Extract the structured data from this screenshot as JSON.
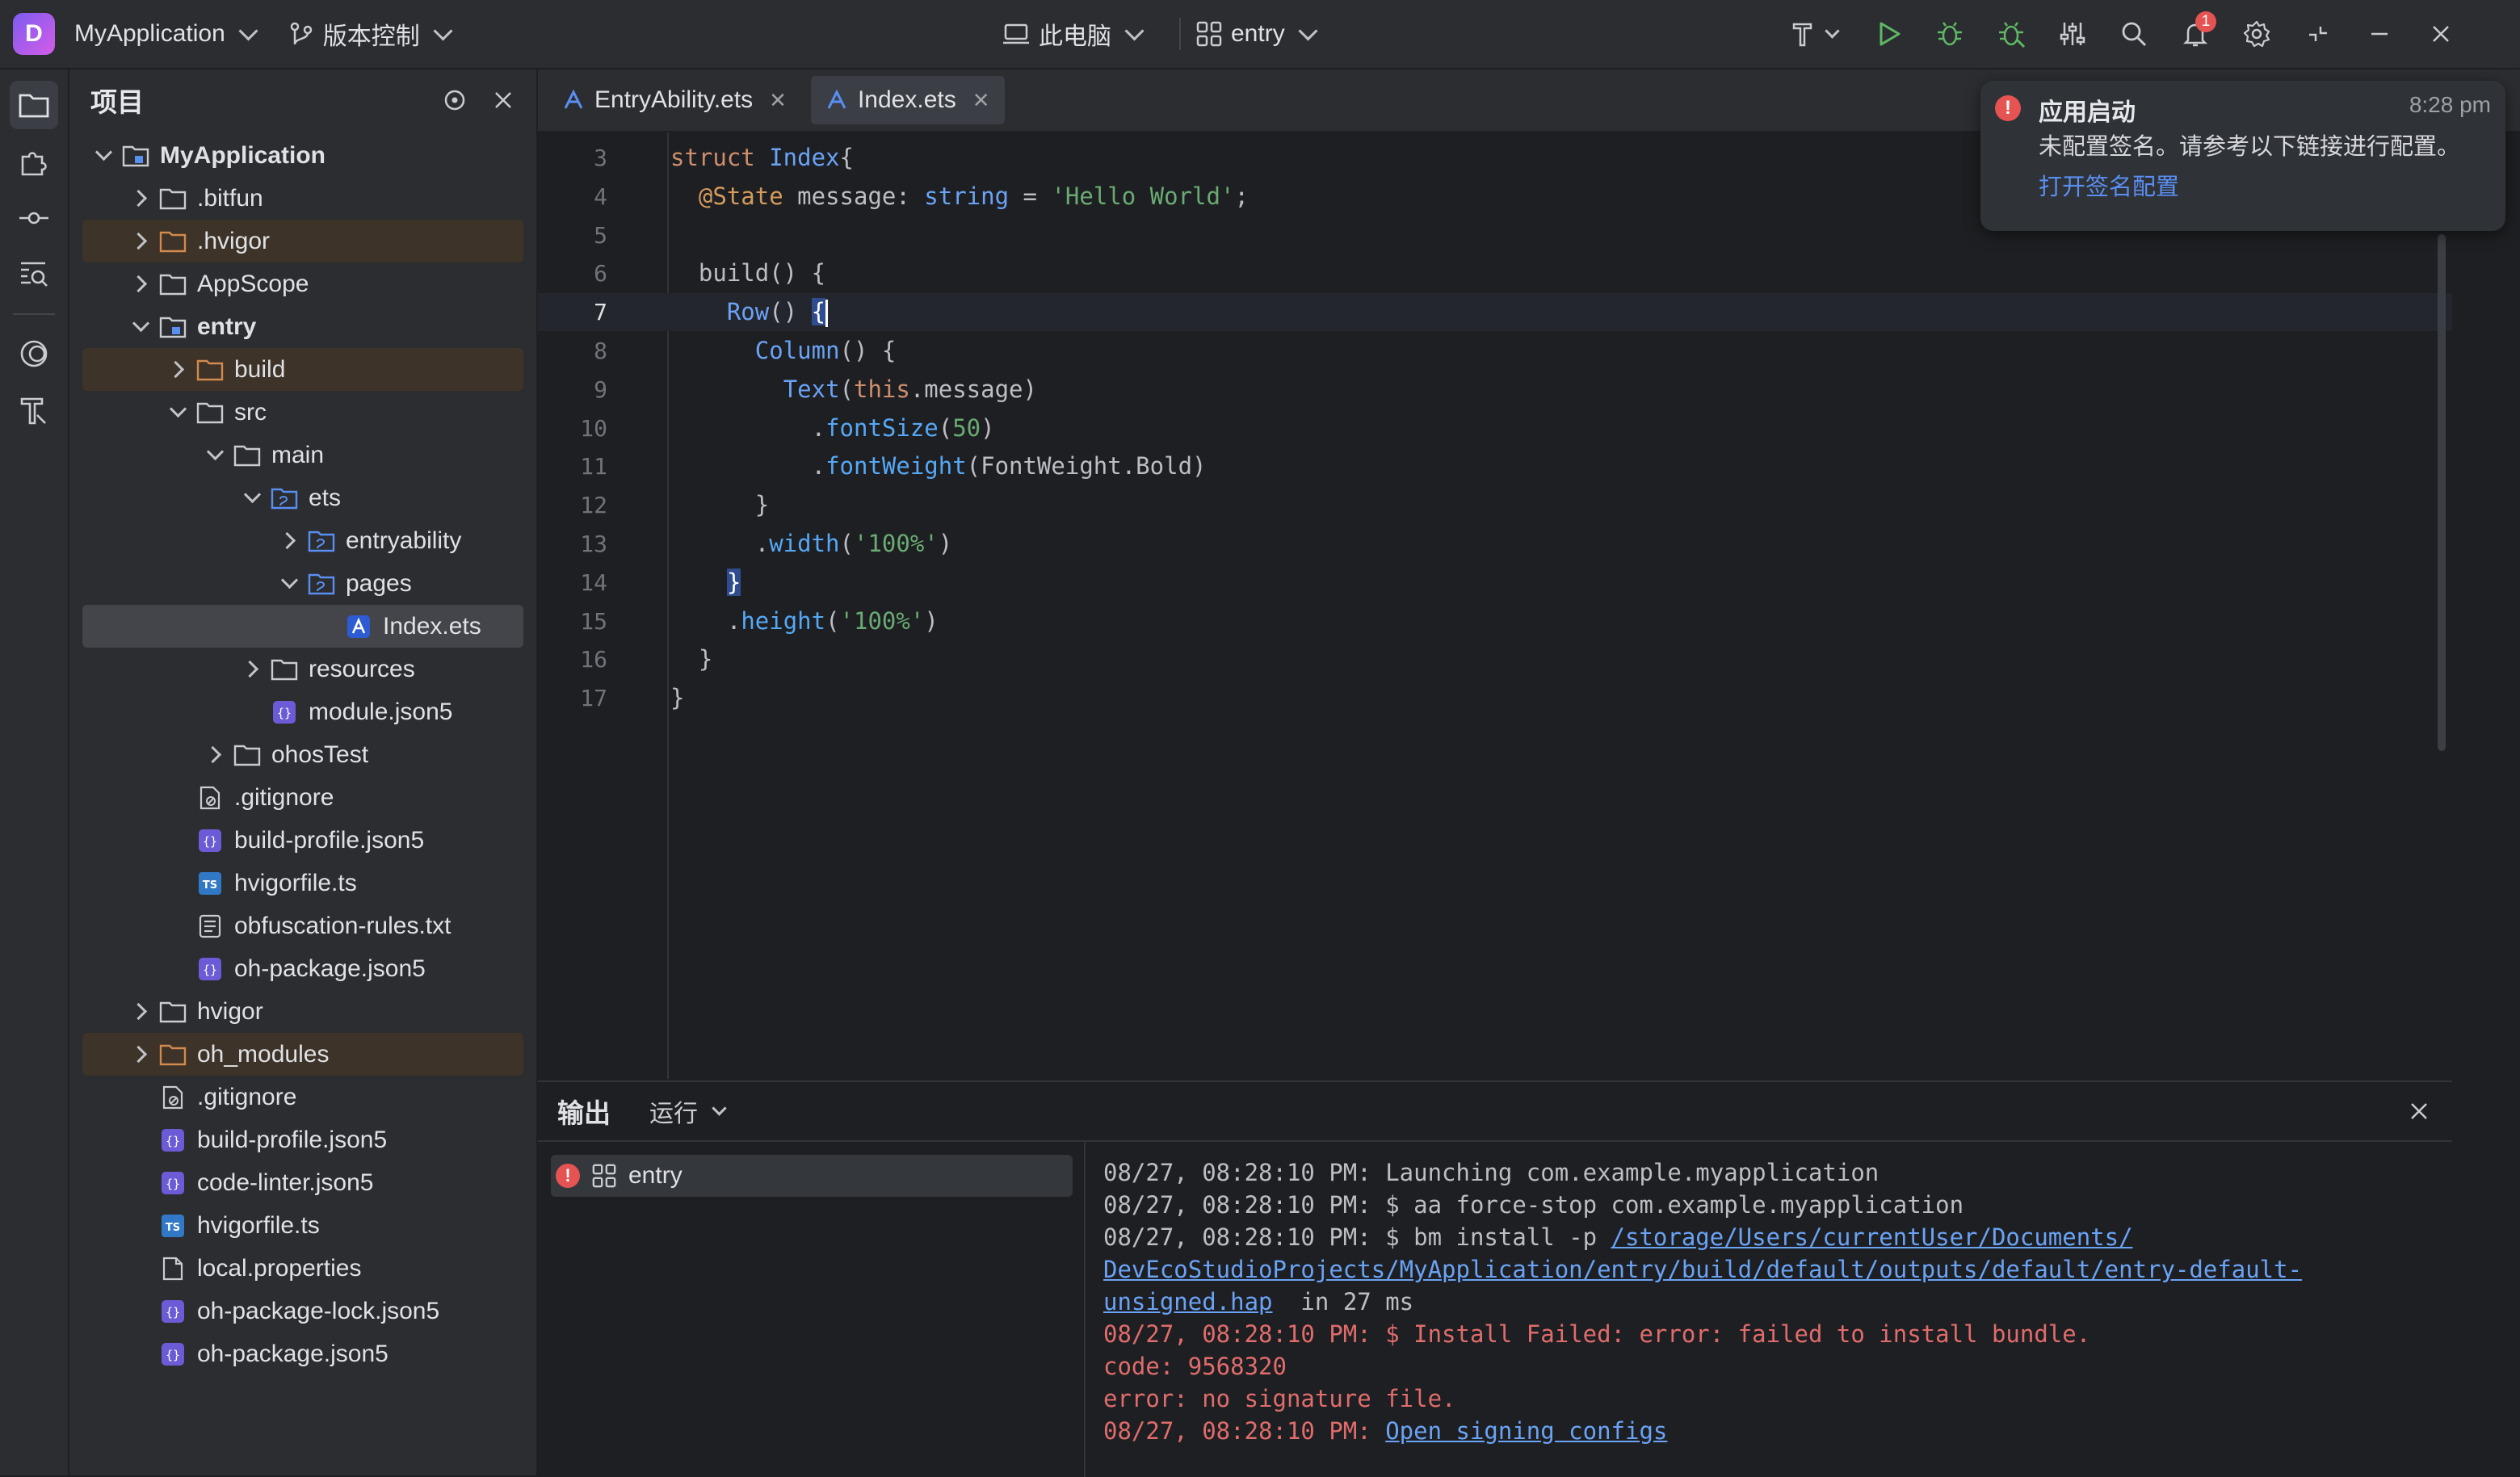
{
  "titlebar": {
    "project_name": "MyApplication",
    "vcs_label": "版本控制",
    "device_label": "此电脑",
    "module_label": "entry",
    "notification_count": "1"
  },
  "project_panel": {
    "title": "项目",
    "tree": [
      {
        "label": "MyApplication",
        "depth": 0,
        "expand": "open",
        "icon": "module-folder-icon",
        "bold": true
      },
      {
        "label": ".bitfun",
        "depth": 1,
        "expand": "closed",
        "icon": "folder-icon"
      },
      {
        "label": ".hvigor",
        "depth": 1,
        "expand": "closed",
        "icon": "excluded-folder-icon",
        "state": "excluded"
      },
      {
        "label": "AppScope",
        "depth": 1,
        "expand": "closed",
        "icon": "folder-icon"
      },
      {
        "label": "entry",
        "depth": 1,
        "expand": "open",
        "icon": "module-folder-icon",
        "bold": true
      },
      {
        "label": "build",
        "depth": 2,
        "expand": "closed",
        "icon": "excluded-folder-icon",
        "state": "excluded"
      },
      {
        "label": "src",
        "depth": 2,
        "expand": "open",
        "icon": "folder-icon"
      },
      {
        "label": "main",
        "depth": 3,
        "expand": "open",
        "icon": "folder-icon"
      },
      {
        "label": "ets",
        "depth": 4,
        "expand": "open",
        "icon": "source-folder-icon"
      },
      {
        "label": "entryability",
        "depth": 5,
        "expand": "closed",
        "icon": "source-folder-icon"
      },
      {
        "label": "pages",
        "depth": 5,
        "expand": "open",
        "icon": "source-folder-icon"
      },
      {
        "label": "Index.ets",
        "depth": 6,
        "expand": "none",
        "icon": "ets-file-icon",
        "state": "selected"
      },
      {
        "label": "resources",
        "depth": 4,
        "expand": "closed",
        "icon": "folder-icon"
      },
      {
        "label": "module.json5",
        "depth": 4,
        "expand": "none",
        "icon": "json-file-icon"
      },
      {
        "label": "ohosTest",
        "depth": 3,
        "expand": "closed",
        "icon": "folder-icon"
      },
      {
        "label": ".gitignore",
        "depth": 2,
        "expand": "none",
        "icon": "gitignore-file-icon"
      },
      {
        "label": "build-profile.json5",
        "depth": 2,
        "expand": "none",
        "icon": "json-file-icon"
      },
      {
        "label": "hvigorfile.ts",
        "depth": 2,
        "expand": "none",
        "icon": "ts-file-icon"
      },
      {
        "label": "obfuscation-rules.txt",
        "depth": 2,
        "expand": "none",
        "icon": "text-file-icon"
      },
      {
        "label": "oh-package.json5",
        "depth": 2,
        "expand": "none",
        "icon": "json-file-icon"
      },
      {
        "label": "hvigor",
        "depth": 1,
        "expand": "closed",
        "icon": "folder-icon"
      },
      {
        "label": "oh_modules",
        "depth": 1,
        "expand": "closed",
        "icon": "excluded-folder-icon",
        "state": "excluded"
      },
      {
        "label": ".gitignore",
        "depth": 1,
        "expand": "none",
        "icon": "gitignore-file-icon"
      },
      {
        "label": "build-profile.json5",
        "depth": 1,
        "expand": "none",
        "icon": "json-file-icon"
      },
      {
        "label": "code-linter.json5",
        "depth": 1,
        "expand": "none",
        "icon": "json-file-icon"
      },
      {
        "label": "hvigorfile.ts",
        "depth": 1,
        "expand": "none",
        "icon": "ts-file-icon"
      },
      {
        "label": "local.properties",
        "depth": 1,
        "expand": "none",
        "icon": "properties-file-icon"
      },
      {
        "label": "oh-package-lock.json5",
        "depth": 1,
        "expand": "none",
        "icon": "json-file-icon"
      },
      {
        "label": "oh-package.json5",
        "depth": 1,
        "expand": "none",
        "icon": "json-file-icon"
      }
    ]
  },
  "editor": {
    "tabs": [
      {
        "label": "EntryAbility.ets",
        "active": false
      },
      {
        "label": "Index.ets",
        "active": true
      }
    ],
    "current_line": 7,
    "lines": [
      {
        "n": "3",
        "tokens": [
          [
            "kw",
            "struct "
          ],
          [
            "ty",
            "Index"
          ],
          [
            "",
            "{"
          ]
        ]
      },
      {
        "n": "4",
        "tokens": [
          [
            "",
            "  "
          ],
          [
            "an",
            "@State"
          ],
          [
            "",
            " message: "
          ],
          [
            "ty",
            "string"
          ],
          [
            "",
            " = "
          ],
          [
            "str",
            "'Hello World'"
          ],
          [
            "",
            ";"
          ]
        ]
      },
      {
        "n": "5",
        "tokens": []
      },
      {
        "n": "6",
        "tokens": [
          [
            "",
            "  build() {"
          ]
        ]
      },
      {
        "n": "7",
        "tokens": [
          [
            "",
            "    "
          ],
          [
            "ty",
            "Row"
          ],
          [
            "",
            "() "
          ],
          [
            "hl",
            "{"
          ],
          [
            "caret",
            ""
          ]
        ]
      },
      {
        "n": "8",
        "tokens": [
          [
            "",
            "      "
          ],
          [
            "ty",
            "Column"
          ],
          [
            "",
            "() {"
          ]
        ]
      },
      {
        "n": "9",
        "tokens": [
          [
            "",
            "        "
          ],
          [
            "ty",
            "Text"
          ],
          [
            "",
            "("
          ],
          [
            "kw",
            "this"
          ],
          [
            "",
            ".message)"
          ]
        ]
      },
      {
        "n": "10",
        "tokens": [
          [
            "",
            "          ."
          ],
          [
            "fn",
            "fontSize"
          ],
          [
            "",
            "("
          ],
          [
            "str",
            "50"
          ],
          [
            "",
            ")"
          ]
        ]
      },
      {
        "n": "11",
        "tokens": [
          [
            "",
            "          ."
          ],
          [
            "fn",
            "fontWeight"
          ],
          [
            "",
            "(FontWeight.Bold)"
          ]
        ]
      },
      {
        "n": "12",
        "tokens": [
          [
            "",
            "      }"
          ]
        ]
      },
      {
        "n": "13",
        "tokens": [
          [
            "",
            "      ."
          ],
          [
            "fn",
            "width"
          ],
          [
            "",
            "("
          ],
          [
            "str",
            "'100%'"
          ],
          [
            "",
            ")"
          ]
        ]
      },
      {
        "n": "14",
        "tokens": [
          [
            "",
            "    "
          ],
          [
            "hl",
            "}"
          ]
        ]
      },
      {
        "n": "15",
        "tokens": [
          [
            "",
            "    ."
          ],
          [
            "fn",
            "height"
          ],
          [
            "",
            "("
          ],
          [
            "str",
            "'100%'"
          ],
          [
            "",
            ")"
          ]
        ]
      },
      {
        "n": "16",
        "tokens": [
          [
            "",
            "  }"
          ]
        ]
      },
      {
        "n": "17",
        "tokens": [
          [
            "",
            "}"
          ]
        ]
      }
    ]
  },
  "notification": {
    "title": "应用启动",
    "time": "8:28 pm",
    "message": "未配置签名。请参考以下链接进行配置。",
    "link": "打开签名配置"
  },
  "output": {
    "title": "输出",
    "run_tab": "运行",
    "config_item": "entry",
    "log": [
      [
        [
          "",
          "08/27, 08:28:10 PM: Launching com.example.myapplication"
        ]
      ],
      [
        [
          "",
          "08/27, 08:28:10 PM: $ aa force-stop com.example.myapplication"
        ]
      ],
      [
        [
          "",
          "08/27, 08:28:10 PM: $ bm install -p "
        ],
        [
          "link",
          "/storage/Users/currentUser/Documents/"
        ]
      ],
      [
        [
          "link",
          "DevEcoStudioProjects/MyApplication/entry/build/default/outputs/default/entry-default-"
        ]
      ],
      [
        [
          "link",
          "unsigned.hap"
        ],
        [
          "",
          "  in 27 ms"
        ]
      ],
      [
        [
          "err",
          "08/27, 08:28:10 PM: $ Install Failed: error: failed to install bundle."
        ]
      ],
      [
        [
          "err",
          "code: 9568320"
        ]
      ],
      [
        [
          "err",
          "error: no signature file."
        ]
      ],
      [
        [
          "err",
          "08/27, 08:28:10 PM: "
        ],
        [
          "link",
          "Open signing configs"
        ]
      ]
    ]
  },
  "colors": {
    "accent": "#3574f0",
    "error": "#e55353",
    "run_green": "#5fb865",
    "excluded_folder": "#d28a4d"
  }
}
